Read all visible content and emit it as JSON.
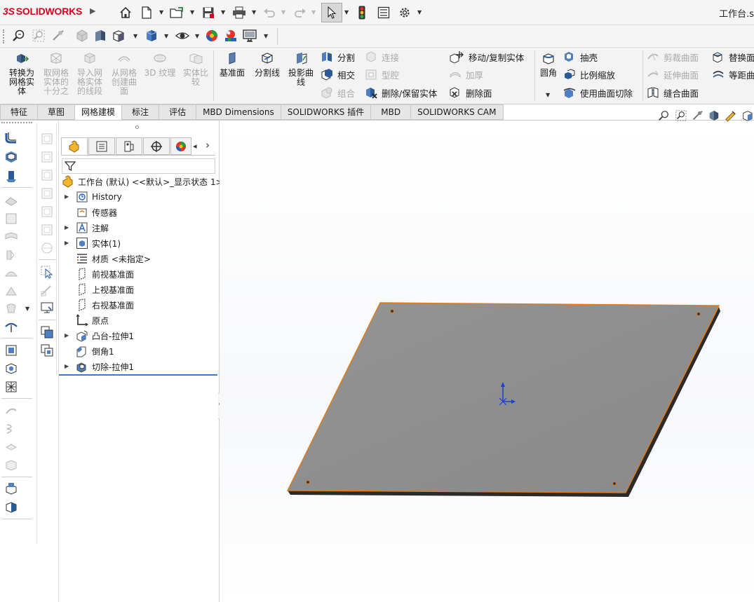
{
  "app": {
    "logo_ds": "3S",
    "logo_text": "SOLIDWORKS",
    "title": "工作台.s"
  },
  "ribbon": {
    "convert": "转换为网格实体",
    "convert_lines": [
      "转换为",
      "网格实",
      "体"
    ],
    "take_mesh": [
      "取网格",
      "实体的",
      "十分之"
    ],
    "import_mesh": [
      "导入网",
      "格实体",
      "的线段"
    ],
    "create_surface": [
      "从网格",
      "创建曲",
      "面"
    ],
    "texture": "3D 纹理",
    "compare": [
      "实体比",
      "较"
    ],
    "ref_plane": "基准面",
    "split_line": "分割线",
    "projected_curve": [
      "投影曲",
      "线"
    ],
    "split": "分割",
    "intersect": "相交",
    "combine": "组合",
    "join": "连接",
    "cavity": "型腔",
    "delete_keep_body": "删除/保留实体",
    "move_copy_body": "移动/复制实体",
    "thicken": "加厚",
    "delete_face": "删除面",
    "fillet": "圆角",
    "shell": "抽壳",
    "scale": "比例缩放",
    "surface_cut": "使用曲面切除",
    "trim_surface": "剪裁曲面",
    "extend_surface": "延伸曲面",
    "knit_surface": "缝合曲面",
    "replace_face": "替换面",
    "offset_surface": "等距曲"
  },
  "tabs": [
    "特征",
    "草图",
    "网格建模",
    "标注",
    "评估",
    "MBD Dimensions",
    "SOLIDWORKS 插件",
    "MBD",
    "SOLIDWORKS CAM"
  ],
  "tree": {
    "root": "工作台 (默认) <<默认>_显示状态 1>",
    "items": [
      {
        "label": "History",
        "icon": "history-icon",
        "expand": true
      },
      {
        "label": "传感器",
        "icon": "sensor-icon",
        "expand": false
      },
      {
        "label": "注解",
        "icon": "annotation-icon",
        "expand": true
      },
      {
        "label": "实体(1)",
        "icon": "solid-bodies-icon",
        "expand": true
      },
      {
        "label": "材质 <未指定>",
        "icon": "material-icon",
        "expand": false
      },
      {
        "label": "前视基准面",
        "icon": "plane-icon",
        "expand": false
      },
      {
        "label": "上视基准面",
        "icon": "plane-icon",
        "expand": false
      },
      {
        "label": "右视基准面",
        "icon": "plane-icon",
        "expand": false
      },
      {
        "label": "原点",
        "icon": "origin-icon",
        "expand": false
      },
      {
        "label": "凸台-拉伸1",
        "icon": "boss-extrude-icon",
        "expand": true
      },
      {
        "label": "倒角1",
        "icon": "chamfer-icon",
        "expand": false
      },
      {
        "label": "切除-拉伸1",
        "icon": "cut-extrude-icon",
        "expand": true
      }
    ]
  },
  "colors": {
    "accent": "#d6001c",
    "edge": "#e07a1a",
    "plate": "#8f8f8f",
    "selection_line": "#2f7fd6"
  }
}
